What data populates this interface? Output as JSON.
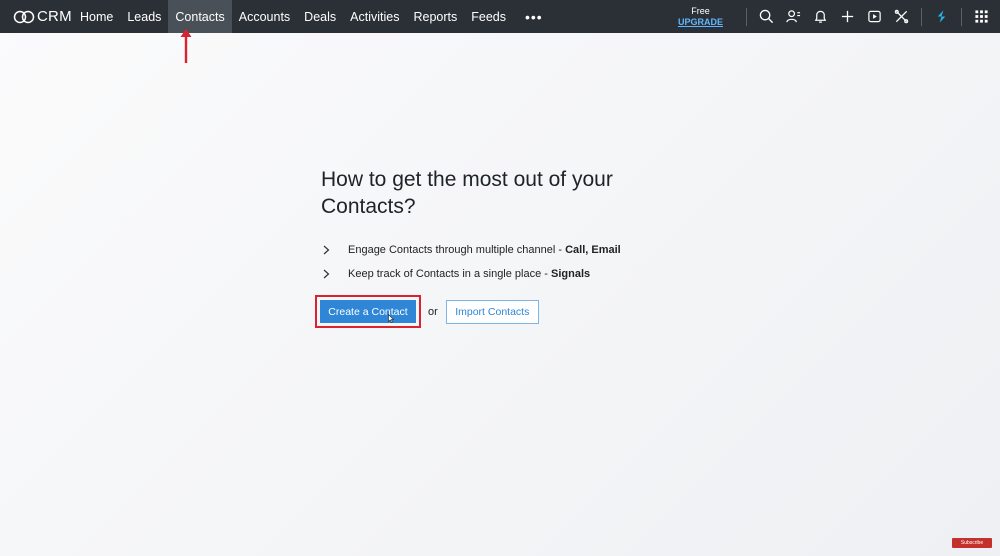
{
  "app": {
    "logo_text": "CRM"
  },
  "nav": {
    "items": [
      {
        "label": "Home"
      },
      {
        "label": "Leads"
      },
      {
        "label": "Contacts",
        "active": true
      },
      {
        "label": "Accounts"
      },
      {
        "label": "Deals"
      },
      {
        "label": "Activities"
      },
      {
        "label": "Reports"
      },
      {
        "label": "Feeds"
      }
    ],
    "more_label": "•••"
  },
  "plan": {
    "free_label": "Free",
    "upgrade_label": "UPGRADE"
  },
  "toolbar_icons": [
    "search-icon",
    "contacts-directory-icon",
    "bell-icon",
    "plus-icon",
    "media-icon",
    "settings-tools-icon",
    "zia-icon",
    "app-grid-icon"
  ],
  "main": {
    "heading": "How to get the most out of your Contacts?",
    "bullets": [
      {
        "text": "Engage Contacts through multiple channel",
        "sep": " - ",
        "strong": "Call, Email"
      },
      {
        "text": "Keep track of Contacts in a single place",
        "sep": " - ",
        "strong": "Signals"
      }
    ],
    "create_button": "Create a Contact",
    "or_text": "or",
    "import_button": "Import Contacts"
  },
  "overlay": {
    "subscribe_label": "Subscribe"
  },
  "colors": {
    "topbar": "#2b3036",
    "primary": "#2f86d6",
    "annotation": "#d9232f",
    "upgrade": "#5fb6ff"
  }
}
